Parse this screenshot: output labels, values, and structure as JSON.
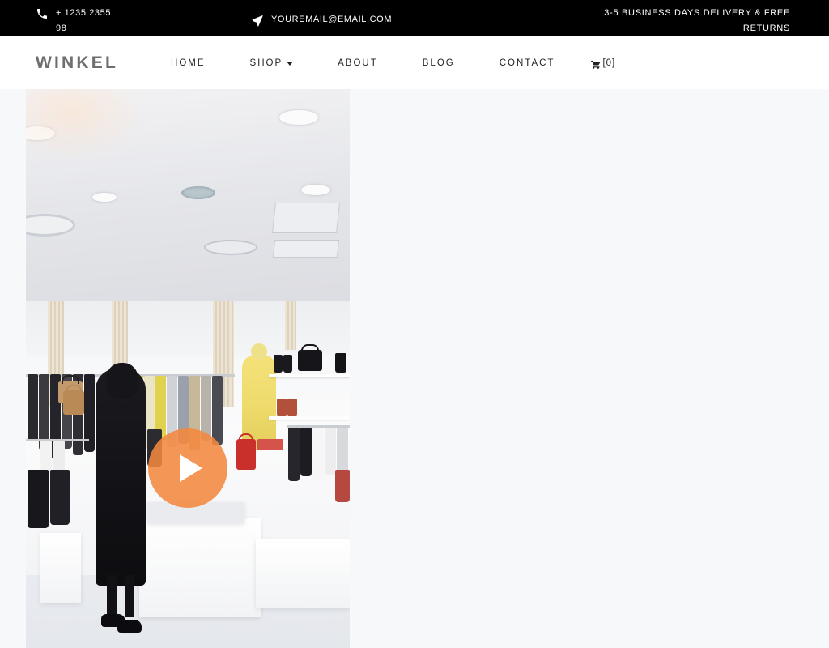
{
  "topbar": {
    "phone": {
      "icon": "phone-icon",
      "text": "+ 1235 2355 98"
    },
    "email": {
      "icon": "paper-plane-icon",
      "text": "YOUREMAIL@EMAIL.COM"
    },
    "shipping": {
      "text": "3-5 BUSINESS DAYS DELIVERY & FREE RETURNS"
    }
  },
  "navbar": {
    "brand": "WINKEL",
    "items": [
      {
        "label": "HOME",
        "has_dropdown": false
      },
      {
        "label": "SHOP",
        "has_dropdown": true
      },
      {
        "label": "ABOUT",
        "has_dropdown": false
      },
      {
        "label": "BLOG",
        "has_dropdown": false
      },
      {
        "label": "CONTACT",
        "has_dropdown": false
      }
    ],
    "cart": {
      "icon": "shopping-cart-icon",
      "count_label": "[0]"
    }
  },
  "main": {
    "video": {
      "alt": "Retail clothing store interior with shopper browsing racks",
      "play_label": "Play video",
      "accent_color": "#f2873e"
    },
    "background_color": "#f7f8fa"
  }
}
